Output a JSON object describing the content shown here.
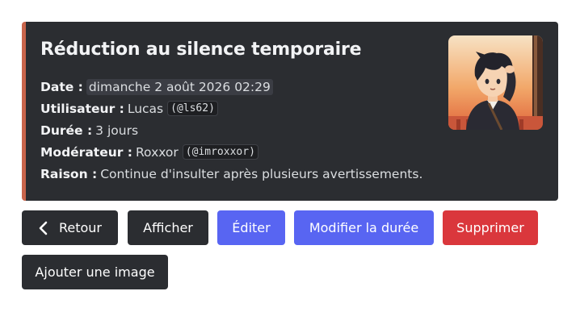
{
  "embed": {
    "title": "Réduction au silence temporaire",
    "accent_color": "#c8644b",
    "fields": {
      "date": {
        "label": "Date :",
        "value": "dimanche 2 août 2026 02:29"
      },
      "user": {
        "label": "Utilisateur :",
        "name": "Lucas",
        "handle": "(@ls62)"
      },
      "duration": {
        "label": "Durée :",
        "value": "3 jours"
      },
      "moderator": {
        "label": "Modérateur :",
        "name": "Roxxor",
        "handle": "(@imroxxor)"
      },
      "reason": {
        "label": "Raison :",
        "value": "Continue d'insulter après plusieurs avertissements."
      }
    },
    "thumbnail_icon": "anime-avatar-image"
  },
  "buttons": {
    "back": {
      "label": "Retour",
      "icon": "chevron-left-icon"
    },
    "view": {
      "label": "Afficher"
    },
    "edit": {
      "label": "Éditer"
    },
    "change_duration": {
      "label": "Modifier la durée"
    },
    "delete": {
      "label": "Supprimer"
    },
    "add_image": {
      "label": "Ajouter une image"
    }
  },
  "colors": {
    "secondary": "#2b2d31",
    "primary": "#5865f2",
    "danger": "#da373c"
  }
}
